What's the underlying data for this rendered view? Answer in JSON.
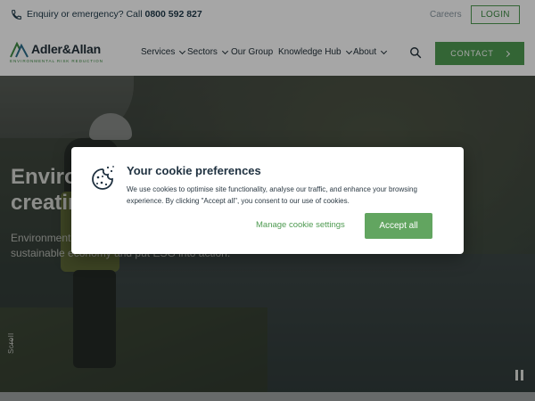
{
  "topbar": {
    "enquiry_prefix": "Enquiry or emergency? Call ",
    "phone": "0800 592 827",
    "careers": "Careers",
    "login": "LOGIN"
  },
  "nav": {
    "logo_name": "Adler&Allan",
    "logo_tagline": "ENVIRONMENTAL RISK REDUCTION",
    "items": [
      {
        "label": "Services"
      },
      {
        "label": "Sectors"
      },
      {
        "label": "Our Group"
      },
      {
        "label": "Knowledge Hub"
      },
      {
        "label": "About"
      }
    ],
    "contact": "CONTACT"
  },
  "hero": {
    "title": "Environmental risk reduction,\ncreating a better future",
    "text": "Environmental services which help build a sustainable economy and put ESG into action.",
    "scroll": "Scroll"
  },
  "cookie_modal": {
    "title": "Your cookie preferences",
    "text": "We use cookies to optimise site functionality, analyse our traffic, and enhance your browsing experience. By clicking \"Accept all\", you consent to our use of cookies.",
    "manage": "Manage cookie settings",
    "accept": "Accept all"
  },
  "colors": {
    "brand_green": "#4f9b52",
    "accept_green": "#62a560",
    "navy": "#1f3140"
  }
}
